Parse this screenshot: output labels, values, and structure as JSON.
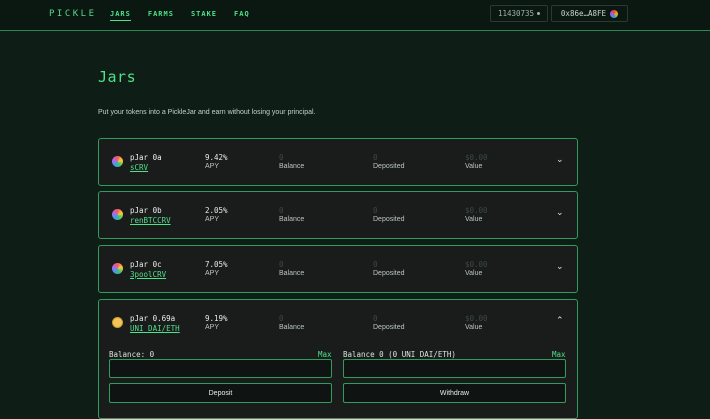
{
  "header": {
    "logo": "PICKLE",
    "nav": [
      "JARS",
      "FARMS",
      "STAKE",
      "FAQ"
    ],
    "block": "11430735",
    "wallet": "0x86e…A8FE"
  },
  "page": {
    "title": "Jars",
    "intro": "Put your tokens into a PickleJar and earn without losing your principal."
  },
  "labels": {
    "apy": "APY",
    "balance": "Balance",
    "deposited": "Deposited",
    "value": "Value"
  },
  "jars": [
    {
      "name": "pJar 0a",
      "token": "sCRV",
      "apy": "9.42%",
      "balance": "0",
      "deposited": "0",
      "value": "$0.00",
      "chevron": "⌄"
    },
    {
      "name": "pJar 0b",
      "token": "renBTCCRV",
      "apy": "2.05%",
      "balance": "0",
      "deposited": "0",
      "value": "$0.00",
      "chevron": "⌄"
    },
    {
      "name": "pJar 0c",
      "token": "3poolCRV",
      "apy": "7.05%",
      "balance": "0",
      "deposited": "0",
      "value": "$0.00",
      "chevron": "⌄"
    },
    {
      "name": "pJar 0.69a",
      "token": "UNI DAI/ETH",
      "apy": "9.19%",
      "balance": "0",
      "deposited": "0",
      "value": "$0.00",
      "chevron": "⌃",
      "expanded": {
        "deposit_balance_label": "Balance: 0",
        "withdraw_balance_label": "Balance 0 (0 UNI DAI/ETH)",
        "max_label": "Max",
        "deposit_value": "",
        "withdraw_value": "",
        "deposit_button": "Deposit",
        "withdraw_button": "Withdraw"
      }
    }
  ]
}
